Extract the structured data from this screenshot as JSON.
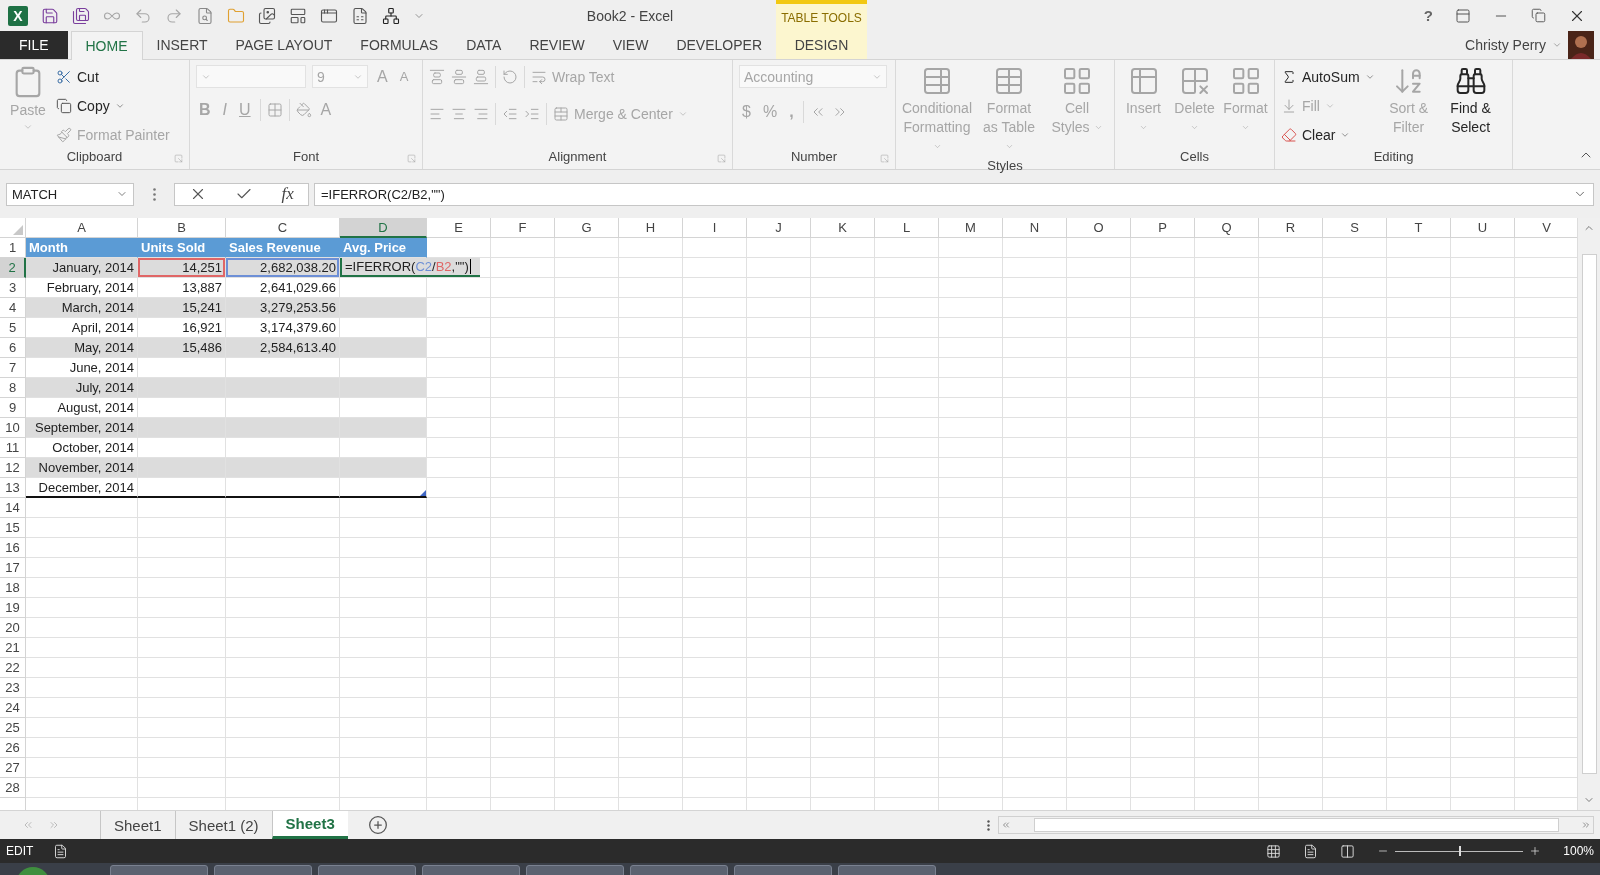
{
  "window": {
    "logo": "X",
    "title": "Book2 - Excel",
    "contextual_header": "TABLE TOOLS",
    "help": "?",
    "user": "Christy Perry"
  },
  "tabs": [
    {
      "label": "FILE",
      "kind": "file",
      "selected": false
    },
    {
      "label": "HOME",
      "kind": "tab",
      "selected": true
    },
    {
      "label": "INSERT",
      "kind": "tab",
      "selected": false
    },
    {
      "label": "PAGE LAYOUT",
      "kind": "tab",
      "selected": false
    },
    {
      "label": "FORMULAS",
      "kind": "tab",
      "selected": false
    },
    {
      "label": "DATA",
      "kind": "tab",
      "selected": false
    },
    {
      "label": "REVIEW",
      "kind": "tab",
      "selected": false
    },
    {
      "label": "VIEW",
      "kind": "tab",
      "selected": false
    },
    {
      "label": "DEVELOPER",
      "kind": "tab",
      "selected": false
    },
    {
      "label": "DESIGN",
      "kind": "contextual",
      "selected": false
    }
  ],
  "ribbon": {
    "groups": [
      {
        "name": "Clipboard",
        "kind": "clipboard",
        "items": [
          {
            "label": "Paste",
            "disabled": true
          },
          {
            "label": "Cut",
            "disabled": false
          },
          {
            "label": "Copy",
            "disabled": false
          },
          {
            "label": "Format Painter",
            "disabled": true
          }
        ]
      },
      {
        "name": "Font",
        "kind": "font",
        "disabled": true,
        "font_size": "9",
        "grow": "A",
        "shrink": "A",
        "bold": "B",
        "italic": "I",
        "underline": "U",
        "font_color": "A"
      },
      {
        "name": "Alignment",
        "kind": "alignment",
        "disabled": true,
        "wrap_text": "Wrap Text",
        "merge": "Merge & Center"
      },
      {
        "name": "Number",
        "kind": "number",
        "disabled": true,
        "format": "Accounting",
        "currency": "$",
        "percent": "%",
        "comma": ","
      },
      {
        "name": "Styles",
        "kind": "styles",
        "items": [
          {
            "label": "Conditional Formatting",
            "disabled": true
          },
          {
            "label": "Format as Table",
            "disabled": true
          },
          {
            "label": "Cell Styles",
            "disabled": true
          }
        ]
      },
      {
        "name": "Cells",
        "kind": "cells",
        "items": [
          {
            "label": "Insert",
            "disabled": true
          },
          {
            "label": "Delete",
            "disabled": true
          },
          {
            "label": "Format",
            "disabled": true
          }
        ]
      },
      {
        "name": "Editing",
        "kind": "editing",
        "items": [
          {
            "label": "AutoSum",
            "disabled": false
          },
          {
            "label": "Fill",
            "disabled": true
          },
          {
            "label": "Clear",
            "disabled": false
          },
          {
            "label": "Sort & Filter",
            "disabled": true
          },
          {
            "label": "Find & Select",
            "disabled": false
          }
        ]
      }
    ]
  },
  "formula_bar": {
    "name_box": "MATCH",
    "fx": "fx",
    "formula": "=IFERROR(C2/B2,\"\")"
  },
  "sheet": {
    "columns": [
      {
        "label": "A",
        "selected": false
      },
      {
        "label": "B",
        "selected": false
      },
      {
        "label": "C",
        "selected": false
      },
      {
        "label": "D",
        "selected": true
      },
      {
        "label": "E",
        "selected": false
      },
      {
        "label": "F",
        "selected": false
      },
      {
        "label": "G",
        "selected": false
      },
      {
        "label": "H",
        "selected": false
      },
      {
        "label": "I",
        "selected": false
      },
      {
        "label": "J",
        "selected": false
      },
      {
        "label": "K",
        "selected": false
      },
      {
        "label": "L",
        "selected": false
      },
      {
        "label": "M",
        "selected": false
      },
      {
        "label": "N",
        "selected": false
      },
      {
        "label": "O",
        "selected": false
      },
      {
        "label": "P",
        "selected": false
      },
      {
        "label": "Q",
        "selected": false
      },
      {
        "label": "R",
        "selected": false
      },
      {
        "label": "S",
        "selected": false
      },
      {
        "label": "T",
        "selected": false
      },
      {
        "label": "U",
        "selected": false
      },
      {
        "label": "V",
        "selected": false
      }
    ],
    "row_headers": [
      {
        "label": "1",
        "selected": false
      },
      {
        "label": "2",
        "selected": true
      },
      {
        "label": "3",
        "selected": false
      },
      {
        "label": "4",
        "selected": false
      },
      {
        "label": "5",
        "selected": false
      },
      {
        "label": "6",
        "selected": false
      },
      {
        "label": "7",
        "selected": false
      },
      {
        "label": "8",
        "selected": false
      },
      {
        "label": "9",
        "selected": false
      },
      {
        "label": "10",
        "selected": false
      },
      {
        "label": "11",
        "selected": false
      },
      {
        "label": "12",
        "selected": false
      },
      {
        "label": "13",
        "selected": false
      },
      {
        "label": "14",
        "selected": false
      },
      {
        "label": "15",
        "selected": false
      },
      {
        "label": "16",
        "selected": false
      },
      {
        "label": "17",
        "selected": false
      },
      {
        "label": "18",
        "selected": false
      },
      {
        "label": "19",
        "selected": false
      },
      {
        "label": "20",
        "selected": false
      },
      {
        "label": "21",
        "selected": false
      },
      {
        "label": "22",
        "selected": false
      },
      {
        "label": "23",
        "selected": false
      },
      {
        "label": "24",
        "selected": false
      },
      {
        "label": "25",
        "selected": false
      },
      {
        "label": "26",
        "selected": false
      },
      {
        "label": "27",
        "selected": false
      },
      {
        "label": "28",
        "selected": false
      }
    ],
    "table": {
      "banded_rows": true,
      "columns": [
        "Month",
        "Units Sold",
        "Sales Revenue",
        "Avg. Price"
      ],
      "rows": [
        {
          "cells": [
            {
              "text": "January, 2014"
            },
            {
              "text": "14,251",
              "color": "#e06666"
            },
            {
              "text": "2,682,038.20",
              "color": "#6d8fd6"
            }
          ],
          "editing": [
            {
              "text": "=IFERROR("
            },
            {
              "text": "C2",
              "color": "#6d8fd6"
            },
            {
              "text": "/"
            },
            {
              "text": "B2",
              "color": "#e06666"
            },
            {
              "text": ",\"\")"
            }
          ]
        },
        {
          "cells": [
            {
              "text": "February, 2014"
            },
            {
              "text": "13,887"
            },
            {
              "text": "2,641,029.66"
            }
          ]
        },
        {
          "cells": [
            {
              "text": "March, 2014"
            },
            {
              "text": "15,241"
            },
            {
              "text": "3,279,253.56"
            }
          ]
        },
        {
          "cells": [
            {
              "text": "April, 2014"
            },
            {
              "text": "16,921"
            },
            {
              "text": "3,174,379.60"
            }
          ]
        },
        {
          "cells": [
            {
              "text": "May, 2014"
            },
            {
              "text": "15,486"
            },
            {
              "text": "2,584,613.40"
            }
          ]
        },
        {
          "cells": [
            {
              "text": "June, 2014"
            }
          ]
        },
        {
          "cells": [
            {
              "text": "July, 2014"
            }
          ]
        },
        {
          "cells": [
            {
              "text": "August, 2014"
            }
          ]
        },
        {
          "cells": [
            {
              "text": "September, 2014"
            }
          ]
        },
        {
          "cells": [
            {
              "text": "October, 2014"
            }
          ]
        },
        {
          "cells": [
            {
              "text": "November, 2014"
            }
          ]
        },
        {
          "cells": [
            {
              "text": "December, 2014"
            }
          ]
        }
      ]
    }
  },
  "sheet_tabs": [
    {
      "label": "Sheet1",
      "selected": false
    },
    {
      "label": "Sheet1 (2)",
      "selected": false
    },
    {
      "label": "Sheet3",
      "selected": true
    }
  ],
  "status_bar": {
    "mode": "EDIT",
    "zoom": {
      "level": 0.5,
      "reading": "100%"
    }
  }
}
